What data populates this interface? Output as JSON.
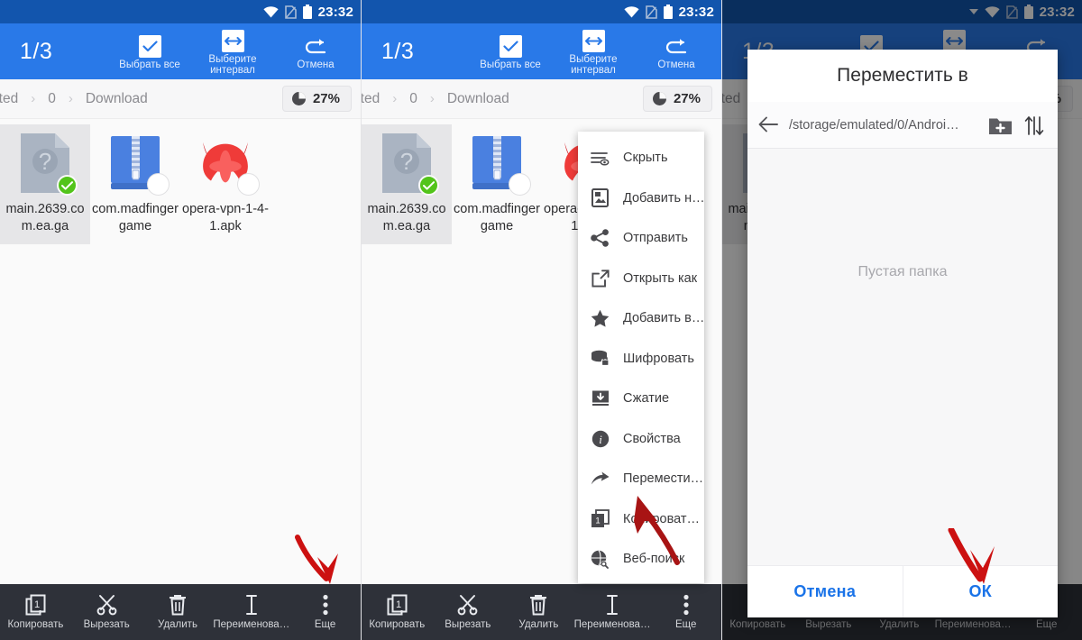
{
  "statusbar": {
    "time": "23:32",
    "icons": [
      "wifi-icon",
      "sim-card-icon",
      "battery-icon"
    ]
  },
  "actionbar": {
    "count": "1/3",
    "select_all": "Выбрать все",
    "select_range": "Выберите интервал",
    "cancel": "Отмена"
  },
  "breadcrumb": {
    "items": [
      "ulated",
      "0",
      "Download"
    ],
    "separator": "›",
    "storage_percent": "27%"
  },
  "files": [
    {
      "name": "main.2639.com.ea.ga",
      "icon": "unknown-file-icon",
      "selected": true,
      "badge": "checkmark-badge"
    },
    {
      "name": "com.madfingergame",
      "icon": "zip-archive-icon",
      "selected": false,
      "badge": "unselected-badge"
    },
    {
      "name": "opera-vpn-1-4-1.apk",
      "icon": "opera-vpn-apk-icon",
      "selected": false,
      "badge": "unselected-badge"
    }
  ],
  "bottombar": {
    "items": [
      {
        "label": "Копировать",
        "icon": "copy-icon"
      },
      {
        "label": "Вырезать",
        "icon": "scissors-icon"
      },
      {
        "label": "Удалить",
        "icon": "trash-icon"
      },
      {
        "label": "Переименова…",
        "icon": "text-cursor-icon"
      },
      {
        "label": "Еще",
        "icon": "overflow-dots-icon"
      }
    ]
  },
  "context_menu": {
    "items": [
      {
        "label": "Скрыть",
        "icon": "hide-icon"
      },
      {
        "label": "Добавить н…",
        "icon": "add-to-home-icon"
      },
      {
        "label": "Отправить",
        "icon": "share-icon"
      },
      {
        "label": "Открыть как",
        "icon": "open-as-icon"
      },
      {
        "label": "Добавить в…",
        "icon": "star-icon"
      },
      {
        "label": "Шифровать",
        "icon": "encrypt-icon"
      },
      {
        "label": "Сжатие",
        "icon": "compress-icon"
      },
      {
        "label": "Свойства",
        "icon": "info-icon"
      },
      {
        "label": "Перемести…",
        "icon": "move-arrow-icon"
      },
      {
        "label": "Копироват…",
        "icon": "copy-icon"
      },
      {
        "label": "Веб-поиск",
        "icon": "web-search-icon"
      }
    ]
  },
  "move_dialog": {
    "title": "Переместить в",
    "path": "/storage/emulated/0/Androi…",
    "back_icon": "back-arrow-icon",
    "new_folder_icon": "new-folder-icon",
    "sort_icon": "sort-icon",
    "empty_text": "Пустая папка",
    "cancel": "Отмена",
    "ok": "ОК"
  },
  "colors": {
    "status_bar": "#1255ad",
    "action_bar": "#2979e8",
    "bottom_bar": "#2e3139",
    "accent_link": "#1a73e8",
    "badge_green": "#52c41a",
    "arrow_red": "#cc1111",
    "zip_blue": "#4a80e0",
    "opera_red": "#ef3b39"
  }
}
